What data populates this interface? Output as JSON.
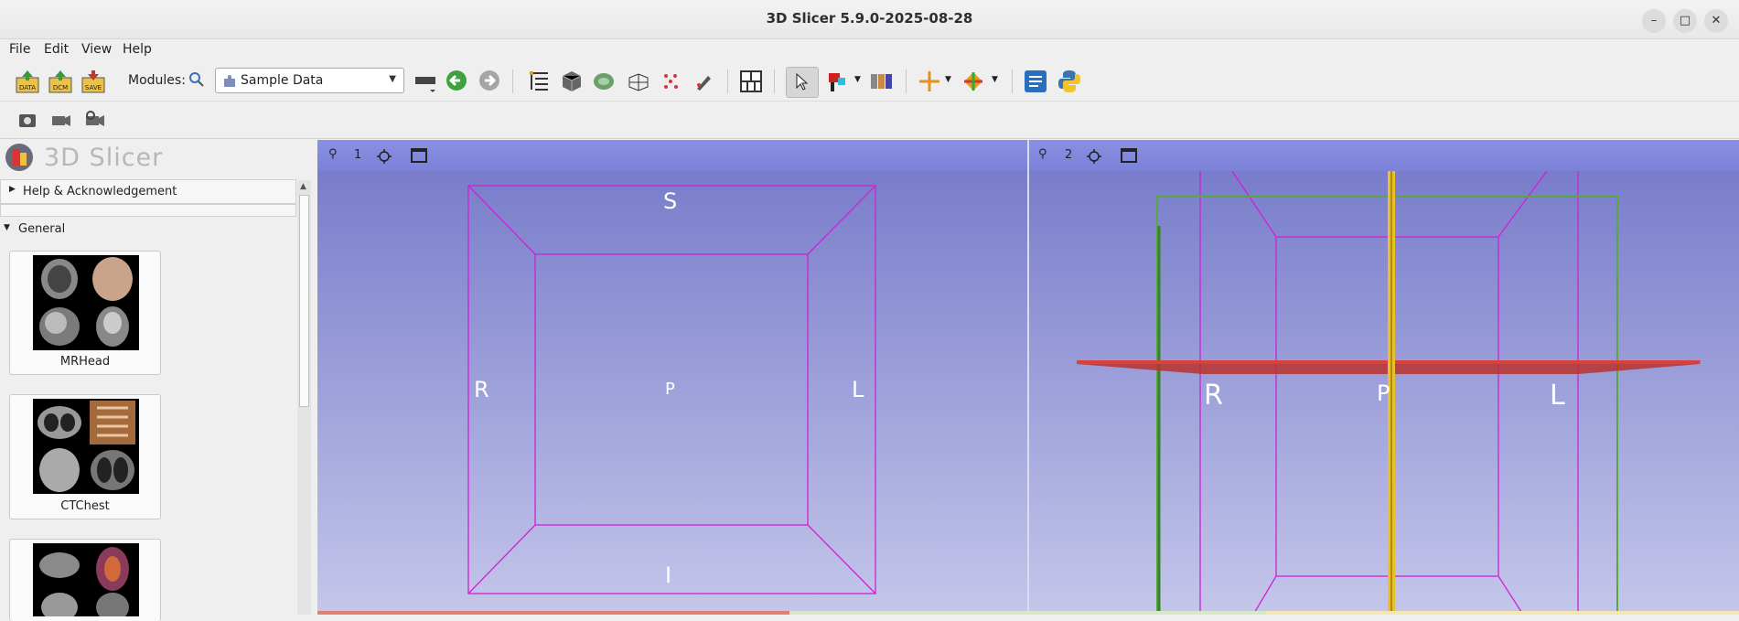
{
  "window": {
    "title": "3D Slicer 5.9.0-2025-08-28"
  },
  "menubar": {
    "items": [
      "File",
      "Edit",
      "View",
      "Help"
    ]
  },
  "toolbar": {
    "modules_label": "Modules:",
    "module_selected": "Sample Data",
    "data_btn": "DATA",
    "dcm_btn": "DCM",
    "save_btn": "SAVE"
  },
  "module_panel": {
    "logo_text": "3D Slicer",
    "help_section": "Help & Acknowledgement",
    "general_section": "General",
    "samples": [
      "MRHead",
      "CTChest",
      ""
    ]
  },
  "views": {
    "view1": {
      "number": "1",
      "labels": {
        "top": "S",
        "bottom": "I",
        "left": "R",
        "right": "L",
        "center": "P"
      },
      "bg_top": "#7b80cc",
      "bg_bottom": "#c2c4e8",
      "box_color": "#d020d6"
    },
    "view2": {
      "number": "2",
      "labels": {
        "left": "R",
        "right": "L",
        "center": "P"
      },
      "box_color": "#d020d6",
      "green_plane_color": "#58a840",
      "red_plane_color": "#d9413a",
      "yellow_plane_color": "#e8c02a"
    }
  },
  "colors": {
    "accent": "#7b82d8"
  }
}
